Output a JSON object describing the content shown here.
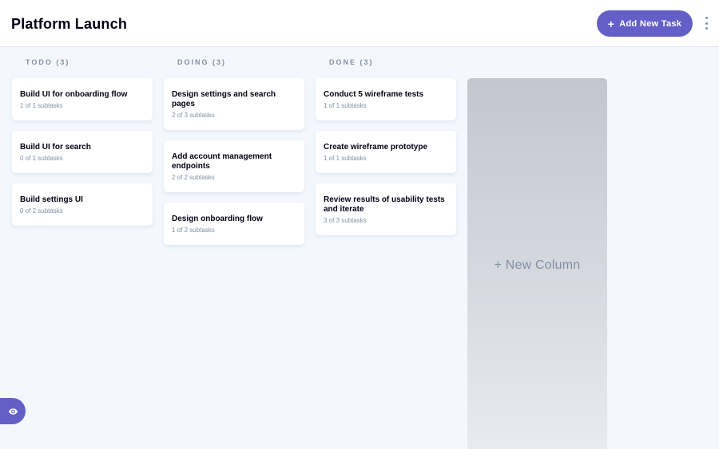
{
  "header": {
    "board_title": "Platform Launch",
    "add_task_label": "Add New Task",
    "add_task_icon": "plus-icon",
    "menu_icon": "vertical-ellipsis-icon"
  },
  "columns": [
    {
      "heading": "TODO (3)",
      "cards": [
        {
          "title": "Build UI for onboarding flow",
          "subtasks": "1 of 1 subtasks"
        },
        {
          "title": "Build UI for search",
          "subtasks": "0 of 1 subtasks"
        },
        {
          "title": "Build settings UI",
          "subtasks": "0 of 2 subtasks"
        }
      ]
    },
    {
      "heading": "DOING (3)",
      "cards": [
        {
          "title": "Design settings and search pages",
          "subtasks": "2 of 3 subtasks"
        },
        {
          "title": "Add account management endpoints",
          "subtasks": "2 of 2 subtasks"
        },
        {
          "title": "Design onboarding flow",
          "subtasks": "1 of 2 subtasks"
        }
      ]
    },
    {
      "heading": "DONE (3)",
      "cards": [
        {
          "title": "Conduct 5 wireframe tests",
          "subtasks": "1 of 1 subtasks"
        },
        {
          "title": "Create wireframe prototype",
          "subtasks": "1 of 1 subtasks"
        },
        {
          "title": "Review results of usability tests and iterate",
          "subtasks": "3 of 3 subtasks"
        }
      ]
    }
  ],
  "new_column_label": "+ New Column",
  "show_sidebar_icon": "eye-icon",
  "colors": {
    "accent": "#635FC7",
    "background": "#F4F7FD",
    "muted_text": "#828FA3",
    "card": "#FFFFFF"
  }
}
